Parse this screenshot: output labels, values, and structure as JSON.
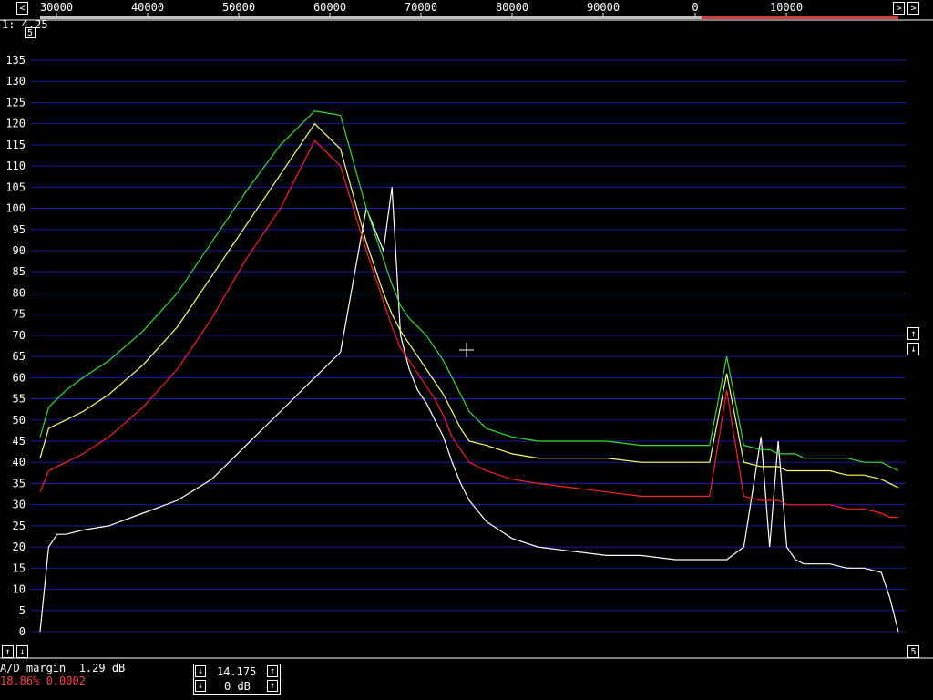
{
  "freq_scale": {
    "labels": [
      "30000",
      "40000",
      "50000",
      "60000",
      "70000",
      "80000",
      "90000",
      "0",
      "10000"
    ],
    "arrow_left": "<",
    "arrow_right": ">"
  },
  "corner": {
    "top_text": "1: 4.25",
    "corner_button": "5"
  },
  "y_axis": {
    "labels": [
      "135",
      "130",
      "125",
      "120",
      "115",
      "110",
      "105",
      "100",
      "95",
      "90",
      "85",
      "80",
      "75",
      "70",
      "65",
      "60",
      "55",
      "50",
      "45",
      "40",
      "35",
      "30",
      "25",
      "20",
      "15",
      "10",
      "5",
      "0"
    ]
  },
  "bottom": {
    "margin_label": "A/D margin  1.29 dB",
    "status_line": "18.86% 0.0002",
    "freq_value": "14.175",
    "gain_value": "0 dB",
    "right_button": "5"
  },
  "colors": {
    "grid": "#1a1aa0",
    "trace_white": "#ffffff",
    "trace_red": "#ff2020",
    "trace_yellow": "#ffff60",
    "trace_green": "#30e030",
    "status": "#ff4040"
  },
  "chart_data": {
    "type": "line",
    "ylim": [
      0,
      135
    ],
    "xlim": [
      0,
      100
    ],
    "series_colors": [
      "#ffffff",
      "#ff2020",
      "#ffff60",
      "#30e030"
    ],
    "x": [
      0,
      1,
      2,
      3,
      5,
      8,
      12,
      16,
      20,
      24,
      28,
      32,
      35,
      38,
      40,
      41,
      42,
      43,
      44,
      45,
      46,
      47,
      48,
      49,
      50,
      52,
      55,
      58,
      62,
      66,
      70,
      74,
      78,
      80,
      82,
      84,
      85,
      86,
      87,
      88,
      89,
      90,
      92,
      94,
      96,
      98,
      99,
      100
    ],
    "series": [
      {
        "values": [
          0,
          20,
          23,
          23,
          24,
          25,
          28,
          31,
          36,
          44,
          52,
          60,
          66,
          100,
          90,
          105,
          70,
          62,
          57,
          54,
          50,
          46,
          40,
          35,
          31,
          26,
          22,
          20,
          19,
          18,
          18,
          17,
          17,
          17,
          20,
          46,
          20,
          45,
          20,
          17,
          16,
          16,
          16,
          15,
          15,
          14,
          8,
          0
        ]
      },
      {
        "values": [
          33,
          38,
          39,
          40,
          42,
          46,
          53,
          62,
          74,
          88,
          100,
          116,
          110,
          90,
          78,
          72,
          67,
          64,
          61,
          58,
          55,
          51,
          46,
          43,
          40,
          38,
          36,
          35,
          34,
          33,
          32,
          32,
          32,
          57,
          32,
          31,
          31,
          31,
          30,
          30,
          30,
          30,
          30,
          29,
          29,
          28,
          27,
          27
        ]
      },
      {
        "values": [
          41,
          48,
          49,
          50,
          52,
          56,
          63,
          72,
          84,
          96,
          108,
          120,
          114,
          92,
          80,
          75,
          71,
          68,
          65,
          62,
          59,
          56,
          52,
          48,
          45,
          44,
          42,
          41,
          41,
          41,
          40,
          40,
          40,
          61,
          40,
          39,
          39,
          39,
          38,
          38,
          38,
          38,
          38,
          37,
          37,
          36,
          35,
          34
        ]
      },
      {
        "values": [
          46,
          53,
          55,
          57,
          60,
          64,
          71,
          80,
          92,
          104,
          115,
          123,
          122,
          100,
          88,
          82,
          77,
          74,
          72,
          70,
          67,
          64,
          60,
          56,
          52,
          48,
          46,
          45,
          45,
          45,
          44,
          44,
          44,
          65,
          44,
          43,
          43,
          42,
          42,
          42,
          41,
          41,
          41,
          41,
          40,
          40,
          39,
          38
        ]
      }
    ]
  }
}
